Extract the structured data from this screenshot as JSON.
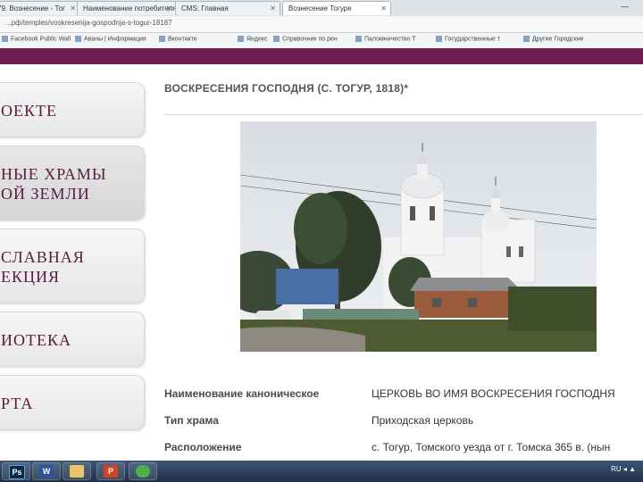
{
  "browser": {
    "tabs": [
      {
        "title": "79. Вознесение - Тог"
      },
      {
        "title": "Наименование потребителя"
      },
      {
        "title": "CMS: Главная"
      },
      {
        "title": "Вознесение Тогуре"
      }
    ],
    "url": "...рф/temples/voskresenija-gospodnja-s-togur-18187",
    "bookmarks": [
      "Facebook Public Wall",
      "Аваны | Информация",
      "Вконтакте",
      "Яндекс",
      "Справочник по рен",
      "Паломничество Т",
      "Государственные т",
      "Другие Городские"
    ]
  },
  "site": {
    "colors": {
      "brand": "#6e1f4f",
      "menu_text": "#5a1a3e"
    },
    "menu": [
      {
        "label": "ОЕКТЕ",
        "label2": ""
      },
      {
        "label": "НЫЕ ХРАМЫ",
        "label2": "ОЙ ЗЕМЛИ"
      },
      {
        "label": "СЛАВНАЯ",
        "label2": "ЕКЦИЯ"
      },
      {
        "label": "ИОТЕКА",
        "label2": ""
      },
      {
        "label": "РТА",
        "label2": ""
      }
    ]
  },
  "content": {
    "title": "ВОСКРЕСЕНИЯ ГОСПОДНЯ (С. ТОГУР, 1818)*",
    "details": [
      {
        "label": "Наименование каноническое",
        "value": "ЦЕРКОВЬ ВО ИМЯ ВОСКРЕСЕНИЯ ГОСПОДНЯ"
      },
      {
        "label": "Тип храма",
        "value": "Приходская церковь"
      },
      {
        "label": "Расположение",
        "value": "с. Тогур, Томского уезда от г. Томска 365 в. (нын"
      }
    ]
  },
  "taskbar": {
    "apps": [
      {
        "icon": "photoshop-icon",
        "letter": "Ps",
        "color": "#0b2a4a"
      },
      {
        "icon": "word-icon",
        "letter": "W",
        "color": "#2b579a"
      },
      {
        "icon": "explorer-icon",
        "letter": "",
        "color": "#e9c46a"
      },
      {
        "icon": "powerpoint-icon",
        "letter": "P",
        "color": "#d04423"
      },
      {
        "icon": "chrome-icon",
        "letter": "",
        "color": "#4caf50"
      }
    ],
    "tray_text": "RU ◂ ▲"
  }
}
